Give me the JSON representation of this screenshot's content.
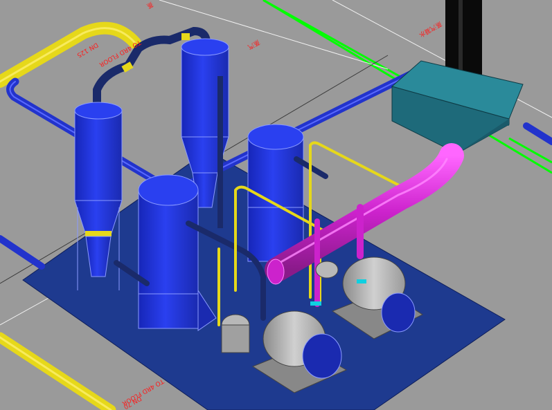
{
  "labels": {
    "floor_upper": "TO 4RD FLOOR",
    "dn_upper": "DN 125",
    "floor_lower": "TO 4RD FLOOR",
    "dn_lower": "DN 70",
    "cad_note_1": "蒸汽",
    "cad_note_2": "蒸汽凝水",
    "cad_note_3": "蒸"
  },
  "colors": {
    "background": "#9a9a9a",
    "base_plate": "#1e3a8f",
    "vessel": "#1f2fd6",
    "vessel_light": "#3a55ff",
    "pipe_blue": "#2233cc",
    "pipe_navy": "#1a2a6a",
    "pipe_yellow": "#e6d81a",
    "pipe_magenta": "#cc2acc",
    "hood": "#1e6a7a",
    "stack": "#0a0a0a",
    "pump_grey": "#b8b8b8",
    "grid_green": "#00ff00",
    "grid_white": "#f2f2f2",
    "label_red": "#ff1a1a"
  }
}
